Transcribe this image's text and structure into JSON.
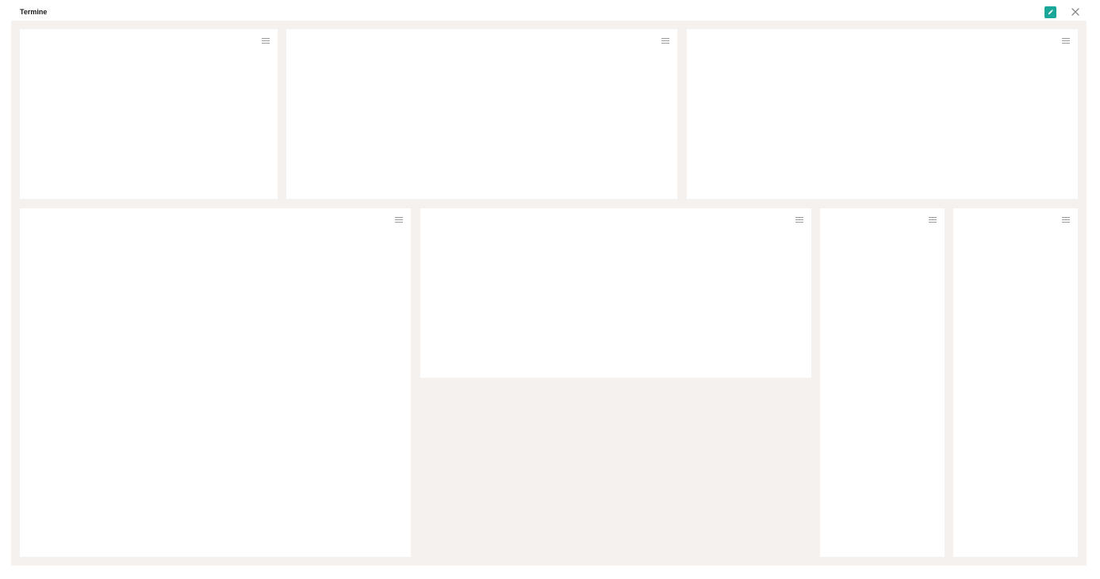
{
  "header": {
    "title": "Termine",
    "edit_icon": "pencil-icon",
    "close_icon": "close-icon",
    "accent_color": "#1aa79a"
  },
  "board": {
    "background": "#f4f1ee",
    "widgets": [
      {
        "id": "widget-1",
        "menu_icon": "hamburger-menu-icon"
      },
      {
        "id": "widget-2",
        "menu_icon": "hamburger-menu-icon"
      },
      {
        "id": "widget-3",
        "menu_icon": "hamburger-menu-icon"
      },
      {
        "id": "widget-4",
        "menu_icon": "hamburger-menu-icon"
      },
      {
        "id": "widget-5",
        "menu_icon": "hamburger-menu-icon"
      },
      {
        "id": "widget-6",
        "menu_icon": "hamburger-menu-icon"
      },
      {
        "id": "widget-7",
        "menu_icon": "hamburger-menu-icon"
      }
    ]
  }
}
